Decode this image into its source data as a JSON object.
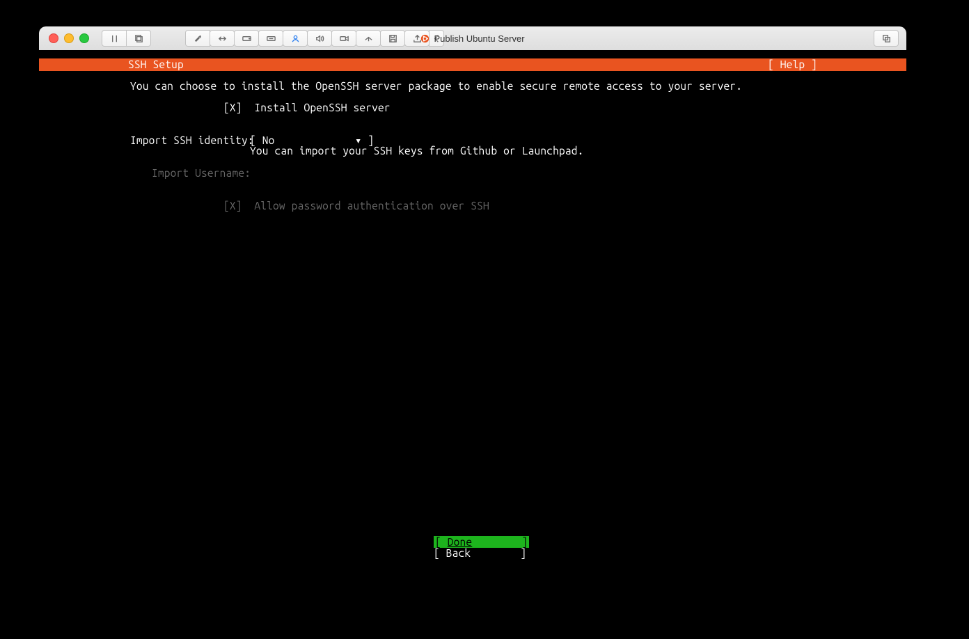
{
  "window": {
    "title": "Publish Ubuntu Server"
  },
  "installer": {
    "page_title": "SSH Setup",
    "help_label": "[ Help ]",
    "intro": "You can choose to install the OpenSSH server package to enable secure remote access to your server.",
    "install_checkbox_mark": "[X]",
    "install_label": "Install OpenSSH server",
    "identity_label": "Import SSH identity:",
    "identity_value": "No",
    "identity_hint": "You can import your SSH keys from Github or Launchpad.",
    "username_label": "Import Username:",
    "allow_pw_mark": "[X]",
    "allow_pw_label": "Allow password authentication over SSH",
    "done_label": "Done",
    "back_label": "Back"
  }
}
